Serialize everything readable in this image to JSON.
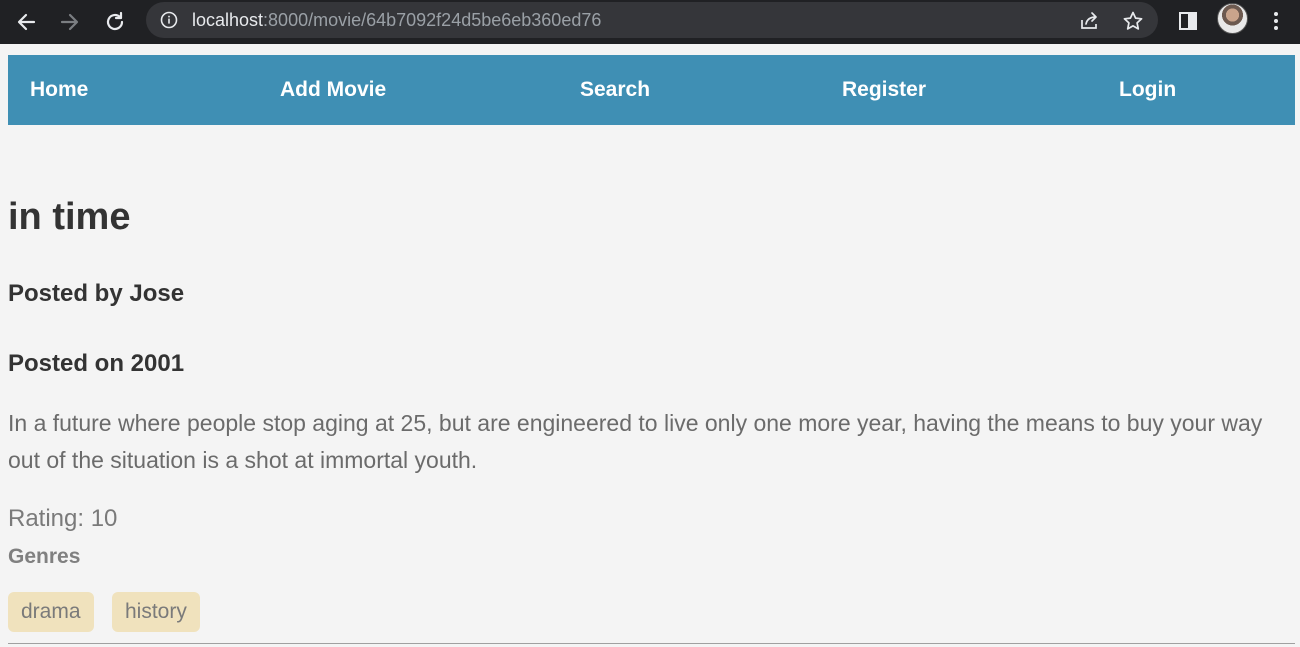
{
  "browser": {
    "url_host": "localhost",
    "url_path": ":8000/movie/64b7092f24d5be6eb360ed76",
    "icons": {
      "back": "back-arrow-icon",
      "forward": "forward-arrow-icon",
      "reload": "reload-icon",
      "info": "info-icon",
      "share": "share-icon",
      "bookmark": "star-icon",
      "sidepanel": "side-panel-icon",
      "menu": "kebab-menu-icon"
    }
  },
  "nav": {
    "background": "#3f8fb4",
    "items": [
      {
        "label": "Home"
      },
      {
        "label": "Add Movie"
      },
      {
        "label": "Search"
      },
      {
        "label": "Register"
      },
      {
        "label": "Login"
      }
    ]
  },
  "movie": {
    "title": "in time",
    "posted_by": "Posted by Jose",
    "posted_on": "Posted on 2001",
    "description": "In a future where people stop aging at 25, but are engineered to live only one more year, having the means to buy your way out of the situation is a shot at immortal youth.",
    "rating": "Rating: 10",
    "genres_label": "Genres",
    "genres": [
      "drama",
      "history"
    ],
    "tag_color": "#f0e2bd"
  }
}
